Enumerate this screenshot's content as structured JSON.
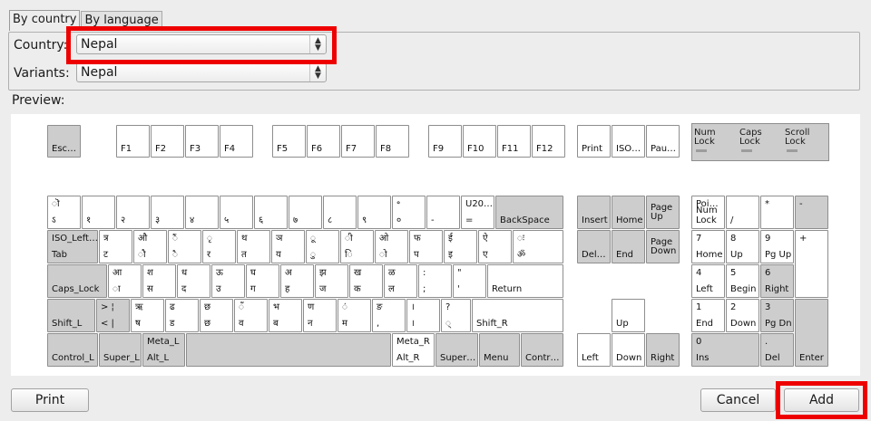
{
  "tabs": [
    {
      "label": "By country",
      "ul": "c"
    },
    {
      "label": "By language",
      "ul": "l"
    }
  ],
  "country": {
    "label": "Country:",
    "value": "Nepal"
  },
  "variants": {
    "label": "Variants:",
    "value": "Nepal"
  },
  "preview_label": "Preview:",
  "leds": {
    "num": "Num\nLock",
    "caps": "Caps\nLock",
    "scroll": "Scroll\nLock"
  },
  "keys": [
    {
      "l": "Esc…"
    },
    {
      "l": "F1"
    },
    {
      "l": "F2"
    },
    {
      "l": "F3"
    },
    {
      "l": "F4"
    },
    {
      "l": "F5"
    },
    {
      "l": "F6"
    },
    {
      "l": "F7"
    },
    {
      "l": "F8"
    },
    {
      "l": "F9"
    },
    {
      "l": "F10"
    },
    {
      "l": "F11"
    },
    {
      "l": "F12"
    },
    {
      "l": "Print"
    },
    {
      "l": "ISO…"
    },
    {
      "l": "Pau…"
    },
    {
      "t": "ॊ",
      "b": "ऽ"
    },
    {
      "b": "१"
    },
    {
      "b": "२"
    },
    {
      "b": "३"
    },
    {
      "b": "४"
    },
    {
      "b": "५"
    },
    {
      "b": "६"
    },
    {
      "b": "७"
    },
    {
      "b": "८"
    },
    {
      "b": "९"
    },
    {
      "t": "॰",
      "b": "०"
    },
    {
      "b": "-"
    },
    {
      "t": "U20…",
      "b": "="
    },
    {
      "l": "BackSpace"
    },
    {
      "t": "ISO_Left…",
      "b": "Tab"
    },
    {
      "t": "त्र",
      "b": "ट"
    },
    {
      "t": "औ",
      "b": "ौ"
    },
    {
      "t": "ैं",
      "b": "ै"
    },
    {
      "t": "ृ",
      "b": "र"
    },
    {
      "t": "थ",
      "b": "त"
    },
    {
      "t": "ञ",
      "b": "य"
    },
    {
      "t": "ू",
      "b": "ु"
    },
    {
      "t": "ी",
      "b": "ि"
    },
    {
      "t": "ओ",
      "b": "ो"
    },
    {
      "t": "फ",
      "b": "प"
    },
    {
      "t": "ई",
      "b": "इ"
    },
    {
      "t": "ऐ",
      "b": "ए"
    },
    {
      "t": "ः",
      "b": "ॐ"
    },
    {
      "l": "Caps_Lock"
    },
    {
      "t": "आ",
      "b": "ा"
    },
    {
      "t": "श",
      "b": "स"
    },
    {
      "t": "ध",
      "b": "द"
    },
    {
      "t": "ऊ",
      "b": "उ"
    },
    {
      "t": "घ",
      "b": "ग"
    },
    {
      "t": "अ",
      "b": "ह"
    },
    {
      "t": "झ",
      "b": "ज"
    },
    {
      "t": "ख",
      "b": "क"
    },
    {
      "t": "ळ",
      "b": "ल"
    },
    {
      "t": ":",
      "b": ";"
    },
    {
      "t": "\"",
      "b": "'"
    },
    {
      "l": "Return"
    },
    {
      "l": "Shift_L"
    },
    {
      "t": "> ¦",
      "b": "< |"
    },
    {
      "t": "ऋ",
      "b": "ष"
    },
    {
      "t": "ढ",
      "b": "ड"
    },
    {
      "t": "छ",
      "b": "छ"
    },
    {
      "t": "ँ",
      "b": "व"
    },
    {
      "t": "भ",
      "b": "ब"
    },
    {
      "t": "ण",
      "b": "न"
    },
    {
      "t": "ं",
      "b": "म"
    },
    {
      "t": "ङ",
      "b": ","
    },
    {
      "t": "।",
      "b": "।"
    },
    {
      "t": "?",
      "b": "्"
    },
    {
      "l": "Shift_R"
    },
    {
      "l": "Control_L"
    },
    {
      "l": "Super_L"
    },
    {
      "t": "Meta_L",
      "b": "Alt_L"
    },
    {
      "l": ""
    },
    {
      "t": "Meta_R",
      "b": "Alt_R"
    },
    {
      "l": "Super…"
    },
    {
      "l": "Menu"
    },
    {
      "l": "Contr…"
    },
    {
      "l": "Insert"
    },
    {
      "l": "Home"
    },
    {
      "l": "Page\nUp"
    },
    {
      "l": "Del…"
    },
    {
      "l": "End"
    },
    {
      "l": "Page\nDown"
    },
    {
      "l": "Up"
    },
    {
      "l": "Left"
    },
    {
      "l": "Down"
    },
    {
      "l": "Right"
    },
    {
      "t": "Poi…",
      "b": "Num\nLock"
    },
    {
      "l": "/"
    },
    {
      "t": "*"
    },
    {
      "t": "-"
    },
    {
      "t": "7",
      "b": "Home"
    },
    {
      "t": "8",
      "b": "Up"
    },
    {
      "t": "9",
      "b": "Pg Up"
    },
    {
      "t": "+"
    },
    {
      "t": "4",
      "b": "Left"
    },
    {
      "t": "5",
      "b": "Begin"
    },
    {
      "t": "6",
      "b": "Right"
    },
    {
      "t": "1",
      "b": "End"
    },
    {
      "t": "2",
      "b": "Down"
    },
    {
      "t": "3",
      "b": "Pg Dn"
    },
    {
      "l": "Enter"
    },
    {
      "t": "0",
      "b": "Ins"
    },
    {
      "t": ".",
      "b": "Del"
    }
  ],
  "buttons": {
    "print": "Print",
    "cancel": "Cancel",
    "add": "Add"
  }
}
